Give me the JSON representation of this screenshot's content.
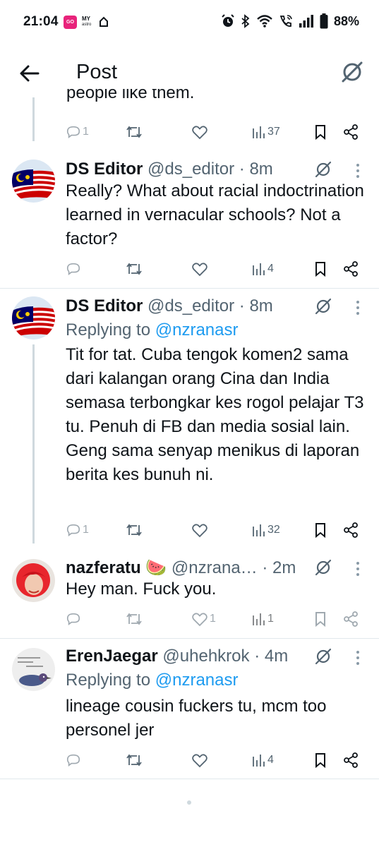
{
  "status_bar": {
    "time": "21:04",
    "app1_label": "GO",
    "app2_label": "MY",
    "app2_sub": "astro",
    "battery": "88%",
    "icons": [
      "alarm-icon",
      "bluetooth-icon",
      "wifi-icon",
      "wifi-call-icon",
      "signal-icon",
      "battery-icon"
    ]
  },
  "header": {
    "title": "Post",
    "back_icon": "arrow-left-icon",
    "grok_icon": "grok-icon"
  },
  "partial_tweet": {
    "text": "people like them.",
    "reply_count": "1",
    "views": "37"
  },
  "tweets": [
    {
      "name": "DS Editor",
      "handle": "@ds_editor",
      "sep": "·",
      "time": "8m",
      "replying_to": "",
      "text": "Really? What about racial indoctrination learned in vernacular schools? Not a factor?",
      "reply_count": "",
      "like_count": "",
      "views": "4"
    },
    {
      "name": "DS Editor",
      "handle": "@ds_editor",
      "sep": "·",
      "time": "8m",
      "replying_label": "Replying to",
      "replying_to": "@nzranasr",
      "text": "Tit for tat. Cuba tengok komen2 sama dari kalangan orang Cina dan India semasa terbongkar kes rogol pelajar T3 tu. Penuh di FB dan media sosial lain. Geng sama senyap menikus di laporan berita kes bunuh ni.",
      "reply_count": "1",
      "like_count": "",
      "views": "32"
    },
    {
      "name": "nazferatu",
      "emoji": "🍉",
      "handle": "@nzrana…",
      "sep": "·",
      "time": "2m",
      "replying_to": "",
      "text": "Hey man. Fuck you.",
      "reply_count": "",
      "like_count": "1",
      "views": "1"
    },
    {
      "name": "ErenJaegar",
      "handle": "@uhehkrok",
      "sep": "·",
      "time": "4m",
      "replying_label": "Replying to",
      "replying_to": "@nzranasr",
      "text": "lineage cousin fuckers tu, mcm too personel jer",
      "reply_count": "",
      "like_count": "",
      "views": "4"
    }
  ],
  "colors": {
    "text": "#0f1419",
    "secondary": "#536471",
    "link": "#1d9bf0",
    "divider": "#e1e8ed",
    "thread_line": "#cfd9de"
  }
}
